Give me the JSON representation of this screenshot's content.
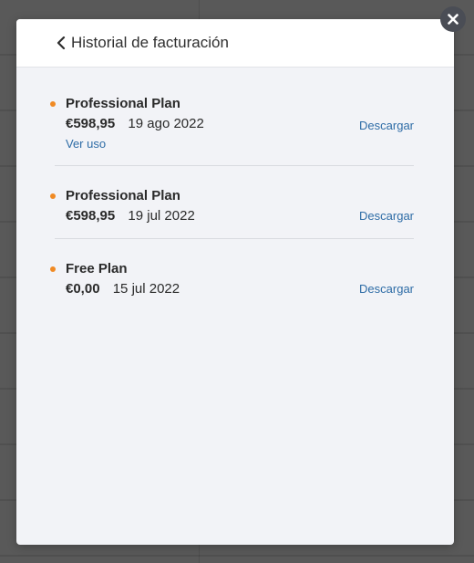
{
  "modal": {
    "title": "Historial de facturación"
  },
  "invoices": [
    {
      "plan": "Professional Plan",
      "price": "€598,95",
      "date": "19 ago 2022",
      "view_usage": "Ver uso",
      "download": "Descargar"
    },
    {
      "plan": "Professional Plan",
      "price": "€598,95",
      "date": "19 jul 2022",
      "download": "Descargar"
    },
    {
      "plan": "Free Plan",
      "price": "€0,00",
      "date": "15 jul 2022",
      "download": "Descargar"
    }
  ],
  "colors": {
    "accent_dot": "#f08a24",
    "link": "#2e6ca6",
    "modal_bg": "#f2f3f7"
  },
  "icons": {
    "back": "chevron-left-icon",
    "close": "close-icon"
  }
}
